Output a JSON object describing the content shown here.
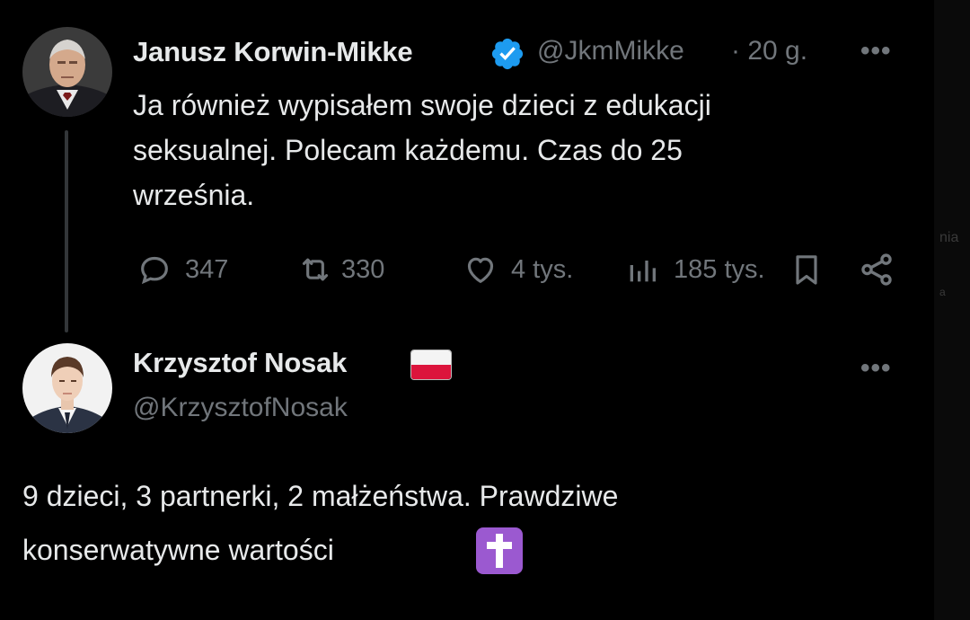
{
  "tweet1": {
    "author_name": "Janusz Korwin-Mikke",
    "handle": "@JkmMikke",
    "time": "· 20 g.",
    "more_label": "•••",
    "text_lines": [
      "Ja również wypisałem swoje dzieci z edukacji",
      "seksualnej. Polecam każdemu. Czas do 25",
      "września."
    ],
    "actions": {
      "replies": "347",
      "reposts": "330",
      "likes": "4 tys.",
      "views": "185 tys."
    },
    "verified_color": "#1d9bf0"
  },
  "tweet2": {
    "author_name": "Krzysztof Nosak",
    "handle": "@KrzysztofNosak",
    "more_label": "•••",
    "text_lines": [
      "9 dzieci, 3 partnerki, 2 małżeństwa. Prawdziwe",
      "konserwatywne wartości"
    ],
    "flag_emoji": "poland-flag",
    "cross_emoji": "latin-cross-emoji"
  },
  "edge_fragments": [
    "nia",
    "a"
  ],
  "colors": {
    "background": "#000000",
    "text": "#e7e9ea",
    "secondary": "#71767b",
    "thread_line": "#333639",
    "emoji_purple": "#9b59d0"
  }
}
